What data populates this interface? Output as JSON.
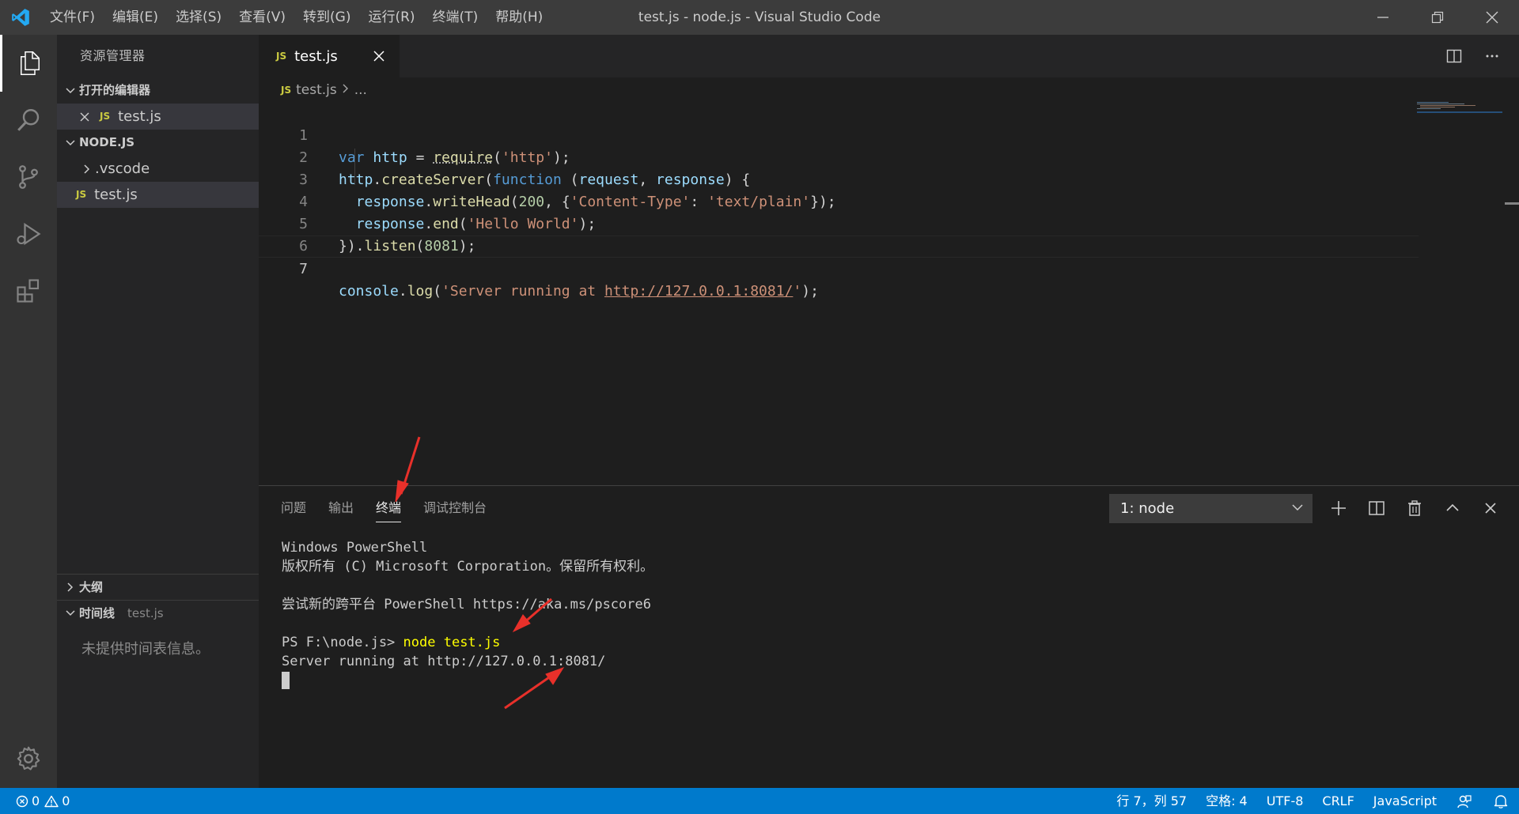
{
  "window": {
    "title": "test.js - node.js - Visual Studio Code"
  },
  "menu": [
    "文件(F)",
    "编辑(E)",
    "选择(S)",
    "查看(V)",
    "转到(G)",
    "运行(R)",
    "终端(T)",
    "帮助(H)"
  ],
  "sidebar": {
    "title": "资源管理器",
    "open_editors": {
      "label": "打开的编辑器",
      "files": [
        "test.js"
      ]
    },
    "folder": {
      "label": "NODE.JS",
      "items": [
        ".vscode",
        "test.js"
      ]
    },
    "outline": {
      "label": "大纲"
    },
    "timeline": {
      "label": "时间线",
      "file": "test.js",
      "message": "未提供时间表信息。"
    }
  },
  "editor": {
    "tab_label": "test.js",
    "breadcrumb": {
      "file": "test.js",
      "rest": "..."
    },
    "line_numbers": [
      "1",
      "2",
      "3",
      "4",
      "5",
      "6",
      "7"
    ]
  },
  "panel": {
    "tabs": [
      "问题",
      "输出",
      "终端",
      "调试控制台"
    ],
    "active_tab": "终端",
    "terminal_select": "1: node",
    "terminal": {
      "line1": "Windows PowerShell",
      "line2": "版权所有 (C) Microsoft Corporation。保留所有权利。",
      "line3": "尝试新的跨平台 PowerShell https://aka.ms/pscore6",
      "prompt": "PS F:\\node.js>",
      "command": "node test.js",
      "output": "Server running at http://127.0.0.1:8081/"
    }
  },
  "status": {
    "errors": "0",
    "warnings": "0",
    "position": "行 7，列 57",
    "spaces": "空格: 4",
    "encoding": "UTF-8",
    "eol": "CRLF",
    "language": "JavaScript"
  },
  "colors": {
    "statusbar": "#007acc",
    "activitybar": "#333333",
    "sidebar": "#252526",
    "editor": "#1e1e1e",
    "annotation": "#e8302a"
  }
}
